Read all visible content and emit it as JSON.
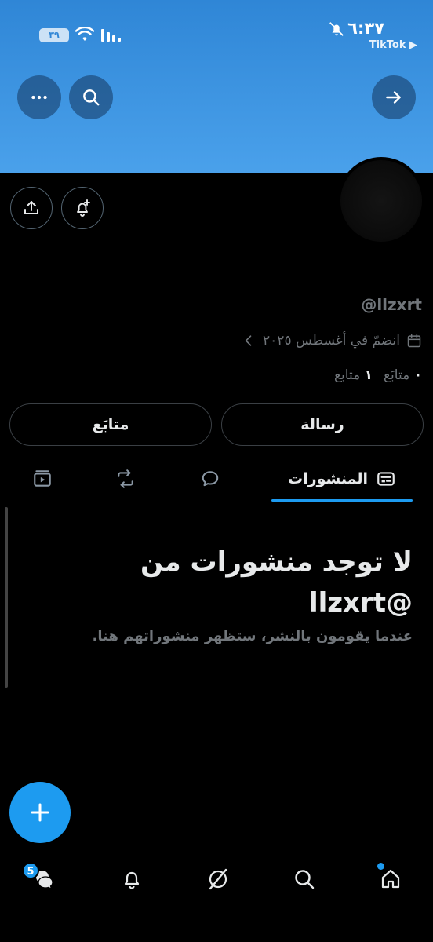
{
  "status_bar": {
    "time": "٦:٣٧",
    "app_label": "TikTok ▶",
    "battery": "٣٩"
  },
  "profile": {
    "handle": "@llzxrt",
    "joined": "انضمّ في أغسطس ٢٠٢٥",
    "following_count": "٠",
    "following_label": "متابَع",
    "followers_count": "١",
    "followers_label": "متابع"
  },
  "actions": {
    "message_label": "رسالة",
    "follow_label": "متابَع"
  },
  "tabs": {
    "posts_label": "المنشورات"
  },
  "empty_state": {
    "title": "لا توجد منشورات من @llzxrt",
    "subtitle": "عندما يقومون بالنشر، ستظهر منشوراتهم هنا."
  },
  "bottom_nav": {
    "messages_badge": "5"
  },
  "colors": {
    "accent": "#1d9bf0",
    "banner": "#4aa1eb",
    "muted_text": "#71767b"
  }
}
